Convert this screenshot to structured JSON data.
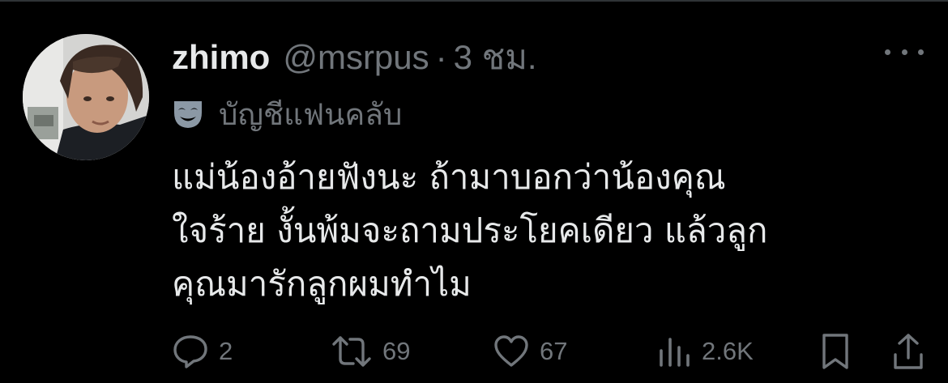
{
  "tweet": {
    "display_name": "zhimo",
    "handle": "@msrpus",
    "separator": "·",
    "time": "3 ชม.",
    "label": "บัญชีแฟนคลับ",
    "label_icon": "theater-mask-icon",
    "text_lines": [
      "แม่น้องอ้ายฟังนะ ถ้ามาบอกว่าน้องคุณ",
      "ใจร้าย งั้นพ้มจะถามประโยคเดียว แล้วลูก",
      "คุณมารักลูกผมทำไม"
    ]
  },
  "actions": {
    "reply": {
      "icon": "reply-icon",
      "count": "2"
    },
    "retweet": {
      "icon": "retweet-icon",
      "count": "69"
    },
    "like": {
      "icon": "heart-icon",
      "count": "67"
    },
    "views": {
      "icon": "views-icon",
      "count": "2.6K"
    },
    "bookmark": {
      "icon": "bookmark-icon"
    },
    "share": {
      "icon": "share-icon"
    }
  },
  "colors": {
    "background": "#000000",
    "primary_text": "#e7e9ea",
    "secondary_text": "#71767b",
    "divider": "#2f3336"
  }
}
